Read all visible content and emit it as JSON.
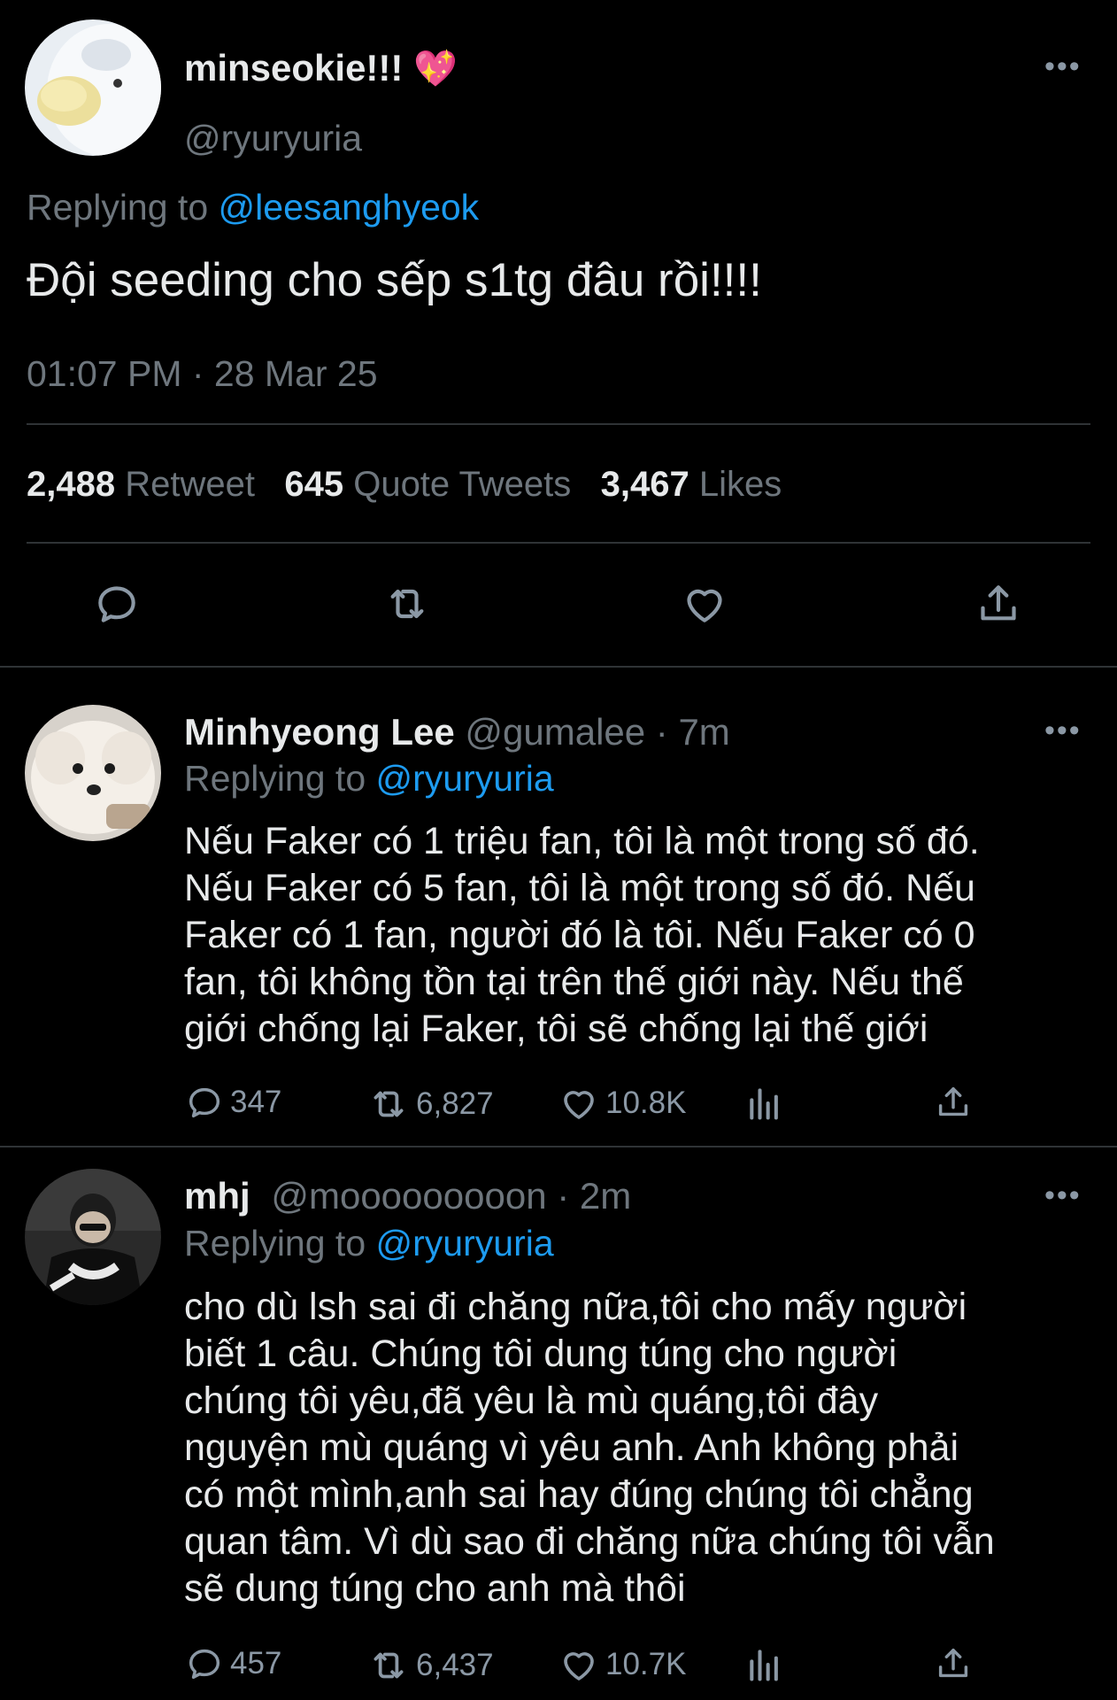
{
  "main_tweet": {
    "display_name": "minseokie!!!",
    "emoji": "💖",
    "handle": "@ryuryuria",
    "replying_prefix": "Replying to",
    "replying_to": "@leesanghyeok",
    "text": "Đội seeding cho sếp s1tg đâu rồi!!!!",
    "timestamp": "01:07 PM · 28 Mar 25",
    "stats": {
      "retweets_count": "2,488",
      "retweets_label": "Retweet",
      "quotes_count": "645",
      "quotes_label": "Quote Tweets",
      "likes_count": "3,467",
      "likes_label": "Likes"
    },
    "more_label": "•••"
  },
  "replies": [
    {
      "display_name": "Minhyeong Lee",
      "handle": "@gumalee",
      "time": "· 7m",
      "replying_prefix": "Replying to",
      "replying_to": "@ryuryuria",
      "text": "Nếu Faker có 1 triệu fan, tôi là một trong số đó.\nNếu Faker có 5 fan, tôi là một trong số đó. Nếu\nFaker có 1 fan, người đó là tôi. Nếu Faker có 0\nfan, tôi không tồn tại trên thế giới này. Nếu thế\ngiới chống lại Faker, tôi sẽ chống lại thế giới",
      "reply_count": "347",
      "retweet_count": "6,827",
      "like_count": "10.8K",
      "more_label": "•••"
    },
    {
      "display_name": "mhj",
      "handle": "@mooooooooon",
      "time": "· 2m",
      "replying_prefix": "Replying to",
      "replying_to": "@ryuryuria",
      "text": "cho dù lsh sai đi chăng nữa,tôi cho mấy người\nbiết 1 câu. Chúng tôi dung túng cho người\nchúng tôi yêu,đã yêu là mù quáng,tôi đây\nnguyện mù quáng vì yêu anh. Anh không phải\ncó một mình,anh sai hay đúng chúng tôi chẳng\nquan tâm. Vì dù sao đi chăng nữa chúng tôi vẫn\nsẽ dung túng cho anh mà thôi",
      "reply_count": "457",
      "retweet_count": "6,437",
      "like_count": "10.7K",
      "more_label": "•••"
    }
  ],
  "icons": {
    "reply": "reply-icon",
    "retweet": "retweet-icon",
    "like": "heart-icon",
    "share": "share-icon",
    "analytics": "analytics-icon",
    "more": "more-icon"
  },
  "colors": {
    "background": "#000000",
    "text": "#e7e9ea",
    "muted": "#6e767d",
    "link": "#1d9bf0",
    "divider": "#2f3336"
  }
}
